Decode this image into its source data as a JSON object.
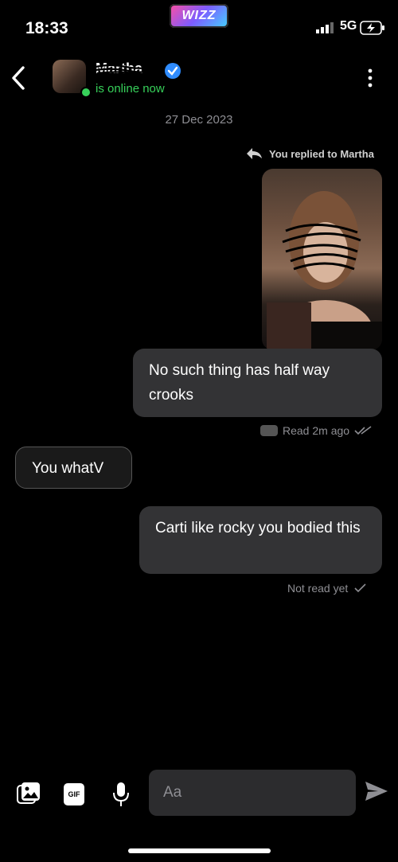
{
  "status_bar": {
    "time": "18:33",
    "app_badge": "WIZZ",
    "network": "5G"
  },
  "header": {
    "contact_name": "Martha",
    "presence": "is online now",
    "online_color": "#37d15a"
  },
  "conversation": {
    "date": "27 Dec 2023",
    "reply_note": "You replied to Martha",
    "messages": [
      {
        "side": "out",
        "text": "No such thing has half way crooks"
      },
      {
        "side": "in",
        "text": "You whatV"
      },
      {
        "side": "out",
        "text": "Carti like rocky you bodied this"
      }
    ],
    "receipts": {
      "first": "Read 2m ago",
      "second": "Not read yet"
    }
  },
  "composer": {
    "placeholder": "Aa",
    "gif_label": "GIF"
  },
  "icons": [
    "back-arrow-icon",
    "verified-icon",
    "more-options-icon",
    "reply-icon",
    "check-icon",
    "gallery-icon",
    "gif-icon",
    "microphone-icon",
    "send-icon"
  ]
}
